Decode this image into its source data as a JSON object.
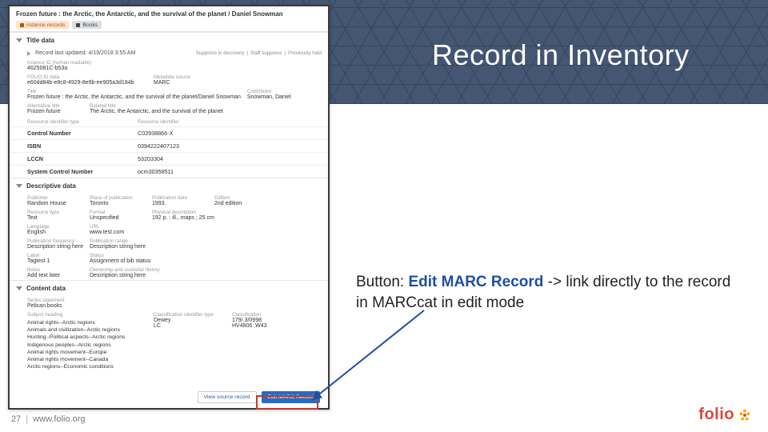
{
  "slide": {
    "title": "Record in Inventory",
    "page_number": "27",
    "footer_url": "www.folio.org",
    "logo_text": "folio"
  },
  "annotation": {
    "prefix": "Button: ",
    "button_name": "Edit MARC Record",
    "suffix": " -> link directly to the record in MARCcat in edit mode"
  },
  "record": {
    "title": "Frozen future : the Arctic, the Antarctic, and the survival of the planet / Daniel Snowman",
    "tags": {
      "instance_count": "nstance records",
      "books": "Books"
    },
    "sections": {
      "title_data": "Title data",
      "record_last_updated": "Record last updated: 4/19/2018 3:55 AM",
      "suppress_links": {
        "a": "Suppress in discovery",
        "b": "Staff suppress",
        "c": "Previously held"
      },
      "instance_id_label": "nstance ID (human readable)",
      "instance_id_value": "4625081C-b53a",
      "folio_id_label": "FOLIO ID data",
      "folio_id_value": "e60dd84b-e8c8-4929-8e9b-ee905a3d184b",
      "metadata_source_label": "Metadata source",
      "metadata_source_value": "MARC",
      "title_label": "Title",
      "title_value": "Frozen future : the Arctic, the Antarctic, and the survival of the planet/Daniel Snowman",
      "contributor_label": "Contributor",
      "contributor_value": "Snowman, Daniel",
      "alt_title_label": "Alternative title",
      "alt_title_value": "Frozen future",
      "related_title_label": "Related title",
      "related_title_value": "The Arctic, the Antarctic, and the survival of the planet",
      "identifier_type_header": "Resource identifier type",
      "identifier_value_header": "Resource identifier",
      "identifiers": [
        {
          "type": "Control Number",
          "value": "C02938866-X"
        },
        {
          "type": "ISBN",
          "value": "0394222407123"
        },
        {
          "type": "LCCN",
          "value": "53203304"
        },
        {
          "type": "System Control Number",
          "value": "ocm30358511"
        }
      ],
      "descriptive": "Descriptive data",
      "publisher_label": "Publisher",
      "publisher_value": "Random House",
      "place_label": "Place of publication",
      "place_value": "Toronto",
      "date_label": "Publication date",
      "date_value": "1993.",
      "edition_label": "Edition",
      "edition_value": "2nd edition",
      "restype_label": "Resource type",
      "restype_value": "Text",
      "format_label": "Format",
      "format_value": "Unspecified",
      "phys_label": "Physical description",
      "phys_value": "192 p. : ill., maps ; 25 cm",
      "lang_label": "Language",
      "lang_value": "English",
      "url_label": "URL",
      "url_value": "www.test.com",
      "freq_label": "Publication frequency",
      "freq_value": "Description string here",
      "range_label": "Publication range",
      "range_value": "Description string here",
      "label_label": "Label",
      "label_value": "Tagtest 1",
      "status_label": "Status",
      "status_value": "Assignment of bib status",
      "notes_label": "Notes",
      "notes_value": "Add text later",
      "own_label": "Ownership and custodial history",
      "own_value": "Description string here",
      "content": "Content data",
      "series_label": "Series statement",
      "series_value": "Pelican books",
      "subj_label": "Subject heading",
      "subjects": [
        "Animal rights--Arctic regions",
        "Animals and civilization--Arctic regions",
        "Hunting--Political aspects--Arctic regions",
        "Indigenous peoples--Arctic regions",
        "Animal rights movement--Europe",
        "Animal rights movement--Canada",
        "Arctic regions--Economic conditions"
      ],
      "class_type_label": "Classification identifier type",
      "class_label": "Classification",
      "class_rows": [
        {
          "t": "Dewey",
          "v": "179/.3/0998"
        },
        {
          "t": "LC",
          "v": "HV4806 .W43"
        }
      ]
    },
    "buttons": {
      "view_source": "View source record",
      "edit_marc": "Edit MARC Record"
    }
  }
}
